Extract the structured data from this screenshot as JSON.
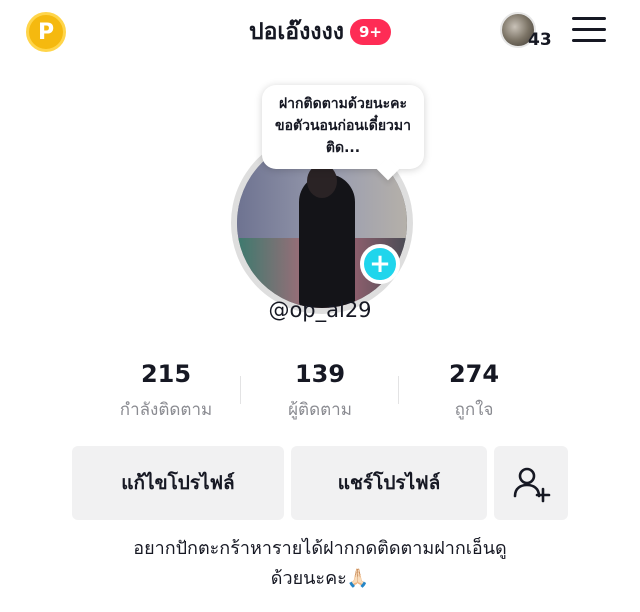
{
  "header": {
    "coin_icon_letter": "P",
    "title": "ปอเอ๊งงงง",
    "notification_badge": "9+",
    "mini_avatar_count": "43",
    "menu_icon": "hamburger-icon"
  },
  "profile": {
    "note_bubble": "ฝากติดตามด้วยนะคะขอตัวนอนก่อนเดี๋ยวมาติด...",
    "handle": "@op_al29",
    "add_icon": "+"
  },
  "stats": [
    {
      "value": "215",
      "label": "กำลังติดตาม"
    },
    {
      "value": "139",
      "label": "ผู้ติดตาม"
    },
    {
      "value": "274",
      "label": "ถูกใจ"
    }
  ],
  "actions": {
    "edit_profile": "แก้ไขโปรไฟล์",
    "share_profile": "แชร์โปรไฟล์",
    "add_friend_icon": "add-user-icon"
  },
  "bio": {
    "line1": "อยากปักตะกร้าหารายได้ฝากกดติดตามฝากเอ็นดู",
    "line2": "ด้วยนะคะ🙏🏻"
  },
  "colors": {
    "coin": "#f5b90f",
    "badge": "#fe2c55",
    "add_badge": "#20d5ec",
    "button_bg": "#f1f1f2",
    "muted_text": "#8a8b91"
  }
}
